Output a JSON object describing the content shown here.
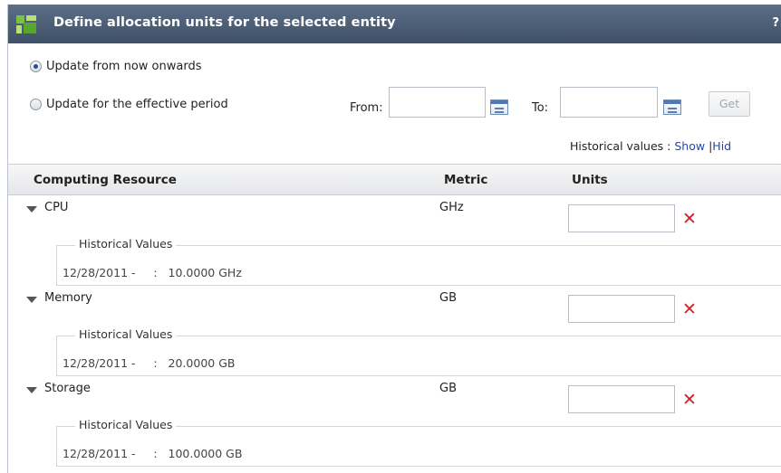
{
  "dialog": {
    "title": "Define allocation units for the selected entity",
    "help_label": "?"
  },
  "update_options": {
    "now": {
      "label": "Update from now onwards",
      "checked": true
    },
    "period": {
      "label": "Update for the effective period",
      "checked": false
    }
  },
  "period": {
    "from_label": "From:",
    "from_value": "",
    "to_label": "To:",
    "to_value": "",
    "get_label": "Get"
  },
  "historical_toggle": {
    "label": "Historical values :",
    "show_label": "Show",
    "separator": "|",
    "hide_label": "Hid"
  },
  "grid": {
    "columns": [
      "Computing Resource",
      "Metric",
      "Units"
    ],
    "rows": [
      {
        "name": "CPU",
        "metric": "GHz",
        "units": "",
        "history_legend": "Historical Values",
        "history_value": "12/28/2011 -     :   10.0000 GHz"
      },
      {
        "name": "Memory",
        "metric": "GB",
        "units": "",
        "history_legend": "Historical Values",
        "history_value": "12/28/2011 -     :   20.0000 GB"
      },
      {
        "name": "Storage",
        "metric": "GB",
        "units": "",
        "history_legend": "Historical Values",
        "history_value": "12/28/2011 -     :   100.0000 GB"
      }
    ]
  },
  "colors": {
    "title_bar": "#4a5b73",
    "link": "#2346b8",
    "delete": "#d3202a"
  },
  "icons": {
    "logo": "app-logo-icon",
    "calendar": "calendar-icon",
    "expander": "triangle-down-icon",
    "delete": "delete-x-icon"
  }
}
